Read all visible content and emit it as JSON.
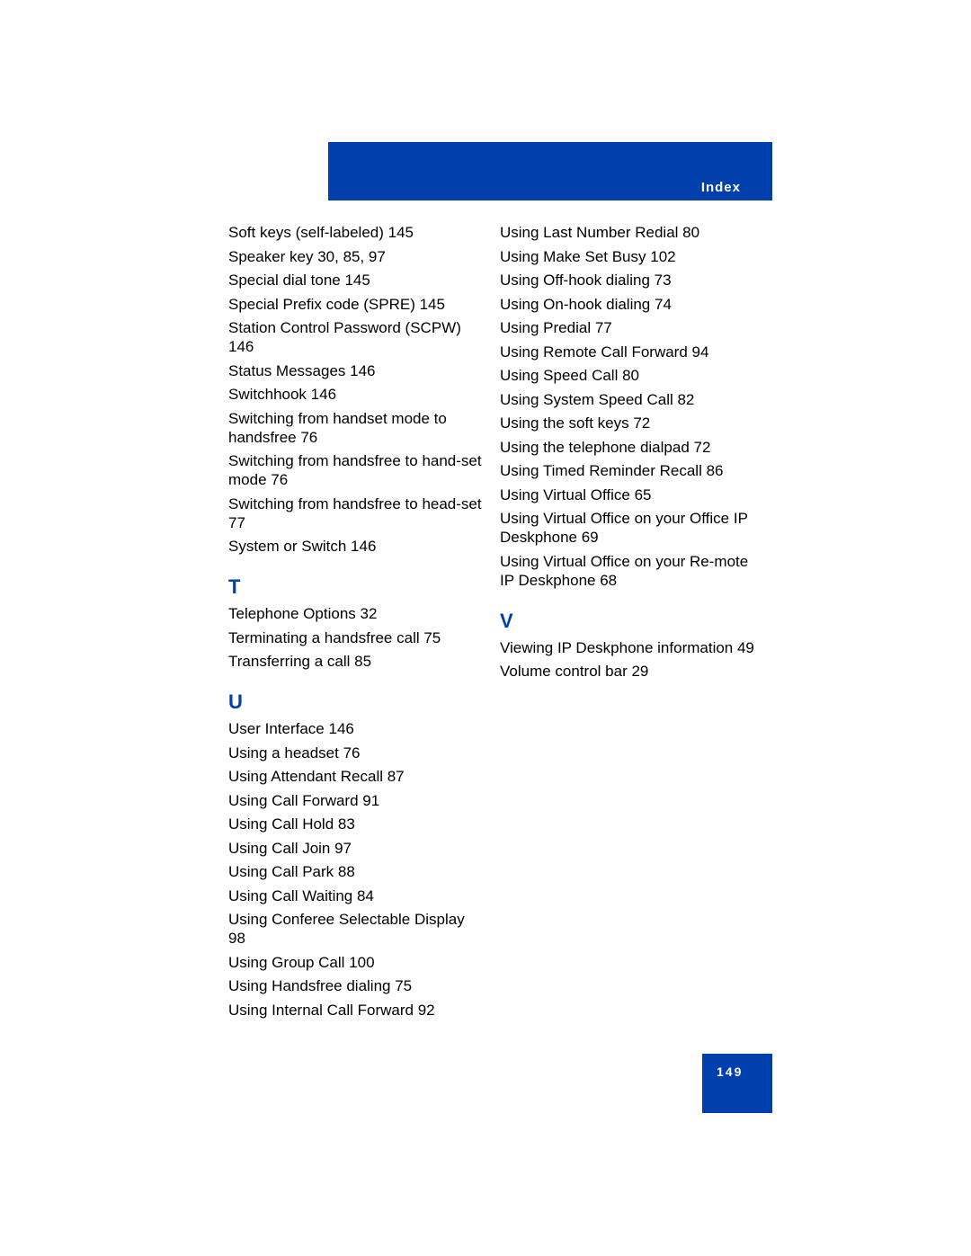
{
  "header": {
    "title": "Index",
    "color": "#0040ad"
  },
  "left_column": {
    "s_entries": [
      "Soft keys (self-labeled) 145",
      "Speaker key 30, 85, 97",
      "Special dial tone 145",
      "Special Prefix code (SPRE) 145",
      "Station Control Password (SCPW) 146",
      "Status Messages 146",
      "Switchhook 146",
      "Switching from handset mode to handsfree 76",
      "Switching from handsfree to hand-set mode 76",
      "Switching from handsfree to head-set 77",
      "System or Switch 146"
    ],
    "t_letter": "T",
    "t_entries": [
      "Telephone Options 32",
      "Terminating a handsfree call 75",
      "Transferring a call 85"
    ],
    "u_letter": "U",
    "u_entries": [
      "User Interface 146",
      "Using a headset 76",
      "Using Attendant Recall 87",
      "Using Call Forward 91",
      "Using Call Hold 83",
      "Using Call Join 97",
      "Using Call Park 88",
      "Using Call Waiting 84",
      "Using Conferee Selectable Display 98",
      "Using Group Call 100",
      "Using Handsfree dialing 75",
      "Using Internal Call Forward 92"
    ]
  },
  "right_column": {
    "u_entries": [
      "Using Last Number Redial 80",
      "Using Make Set Busy 102",
      "Using Off-hook dialing 73",
      "Using On-hook dialing 74",
      "Using Predial 77",
      "Using Remote Call Forward 94",
      "Using Speed Call 80",
      "Using System Speed Call 82",
      "Using the soft keys 72",
      "Using the telephone dialpad 72",
      "Using Timed Reminder Recall 86",
      "Using Virtual Office 65",
      "Using Virtual Office on your Office IP Deskphone 69",
      "Using Virtual Office on your Re-mote IP Deskphone 68"
    ],
    "v_letter": "V",
    "v_entries": [
      "Viewing IP Deskphone information 49",
      "Volume control bar 29"
    ]
  },
  "footer": {
    "page_number": "149"
  }
}
